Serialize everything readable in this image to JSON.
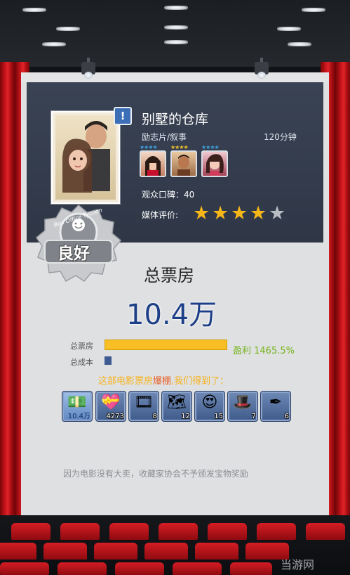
{
  "movie": {
    "title": "别墅的仓库",
    "genre": "励志片/叙事",
    "duration": "120分钟",
    "audience_rating_label": "观众口碑：40",
    "media_rating_label": "媒体评价:",
    "media_rating_stars": 4,
    "media_rating_max": 5,
    "alert_icon": "exclamation-icon"
  },
  "actors": [
    {
      "name": "actor-1",
      "stars": "★★★★",
      "color": "#3da0e0"
    },
    {
      "name": "actor-2",
      "stars": "★★★★",
      "color": "#f0c030"
    },
    {
      "name": "actor-3",
      "stars": "★★★★",
      "color": "#3da0e0"
    }
  ],
  "badge": {
    "text": "良好",
    "ring_text": "Box Office Tycoon"
  },
  "box_office": {
    "heading": "总票房",
    "value": "10.4万",
    "gross_label": "总票房",
    "cost_label": "总成本",
    "profit": "盈利 1465.5%",
    "gross_bar_fraction": 1.0,
    "cost_bar_fraction": 0.06
  },
  "rewards": {
    "heading_prefix": "这部电影票房",
    "heading_highlight": "爆棚",
    "heading_suffix": ",我们得到了：",
    "items": [
      {
        "icon": "money-icon",
        "count": "10.4万"
      },
      {
        "icon": "heart-gift-icon",
        "count": "4273"
      },
      {
        "icon": "film-reel-icon",
        "count": "8"
      },
      {
        "icon": "blueprint-icon",
        "count": "12"
      },
      {
        "icon": "love-face-icon",
        "count": "15"
      },
      {
        "icon": "hat-icon",
        "count": "7"
      },
      {
        "icon": "pen-icon",
        "count": "6"
      }
    ]
  },
  "notice": "因为电影没有大卖，收藏家协会不予颁发宝物奖励",
  "watermark": "当游网",
  "colors": {
    "accent_blue": "#1d3f87",
    "profit_green": "#74b319",
    "gross_bar": "#f7bf23",
    "cost_bar": "#3d5b91",
    "heading_orange": "#f7b21a"
  }
}
